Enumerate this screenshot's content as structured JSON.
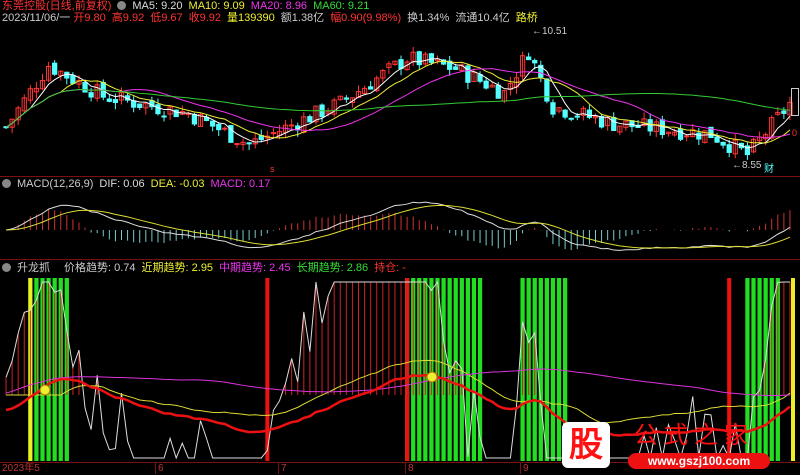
{
  "header": {
    "title": "东莞控股(日线,前复权)",
    "ma5": "MA5: 9.20",
    "ma10": "MA10: 9.09",
    "ma20": "MA20: 8.96",
    "ma60": "MA60: 9.21",
    "date": "2023/11/06/一",
    "open": "开9.80",
    "high": "高9.92",
    "low": "低9.67",
    "close": "收9.92",
    "vol": "量139390",
    "amount": "额1.38亿",
    "change": "幅0.90(9.98%)",
    "turnover": "换1.34%",
    "float": "流通10.4亿",
    "roadmap": "路桥"
  },
  "annotations": {
    "max": "10.51",
    "min": "8.55",
    "r_mark": "0",
    "s_mark": "s",
    "cai": "财"
  },
  "macd": {
    "title": "MACD(12,26,9)",
    "dif": "DIF: 0.06",
    "dea": "DEA: -0.03",
    "macd": "MACD: 0.17"
  },
  "indicator": {
    "title": "升龙抓",
    "price": "价格趋势: 0.74",
    "near": "近期趋势: 2.95",
    "mid": "中期趋势: 2.45",
    "long": "长期趋势: 2.86",
    "hold": "持仓: -"
  },
  "axis": {
    "ticks": [
      "2023年5",
      "6",
      "7",
      "8",
      "9"
    ]
  },
  "logo": {
    "gu": "股",
    "text": "公式之家",
    "url": "www.gszj100.com"
  },
  "colors": {
    "up": "#ff3333",
    "down": "#54ffff",
    "ma5": "#ffffff",
    "ma10": "#eeee33",
    "ma20": "#ee33ee",
    "ma60": "#33cc33"
  },
  "chart_data": {
    "type": "candlestick",
    "candles": 130,
    "price_keys": [
      [
        0,
        9.1
      ],
      [
        7,
        10.0
      ],
      [
        16,
        9.55
      ],
      [
        30,
        9.3
      ],
      [
        40,
        8.85
      ],
      [
        55,
        9.45
      ],
      [
        66,
        10.1
      ],
      [
        74,
        9.95
      ],
      [
        82,
        9.6
      ],
      [
        86,
        10.2
      ],
      [
        90,
        9.4
      ],
      [
        100,
        9.15
      ],
      [
        116,
        9.0
      ],
      [
        122,
        8.7
      ],
      [
        130,
        9.55
      ]
    ],
    "green_zones": [
      [
        4,
        10
      ],
      [
        66,
        78
      ],
      [
        85,
        92
      ],
      [
        122,
        127
      ]
    ],
    "red_bars": [
      43,
      66,
      119
    ],
    "yellow_bars": [
      4,
      131
    ]
  }
}
